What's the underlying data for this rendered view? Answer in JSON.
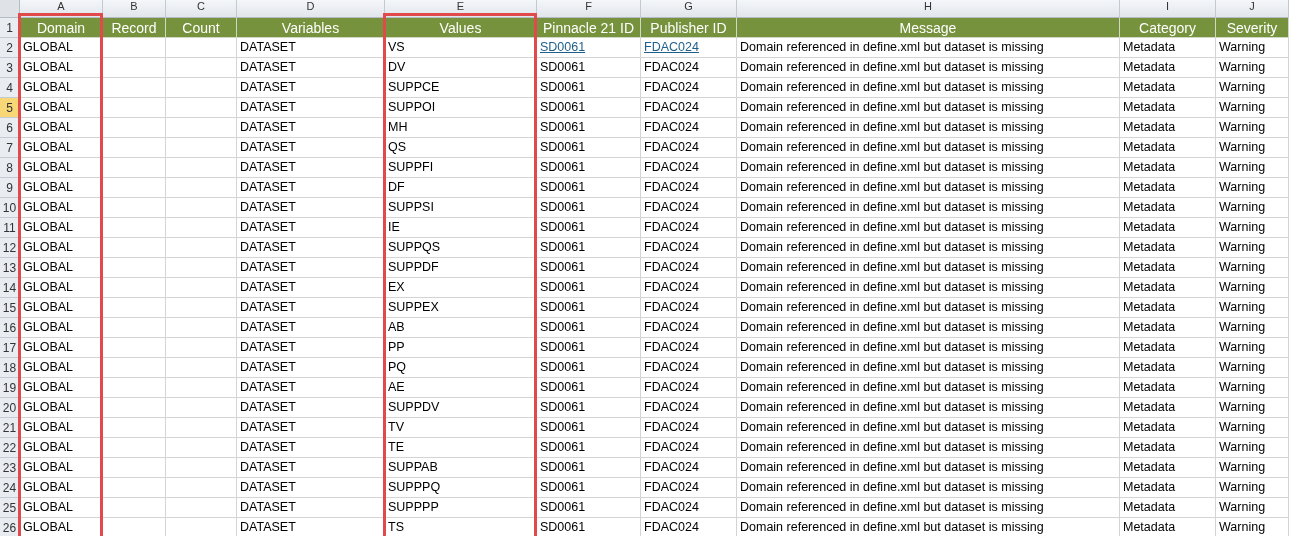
{
  "columns": [
    {
      "letter": "A",
      "heading": "Domain",
      "framed": true
    },
    {
      "letter": "B",
      "heading": "Record",
      "framed": false
    },
    {
      "letter": "C",
      "heading": "Count",
      "framed": false
    },
    {
      "letter": "D",
      "heading": "Variables",
      "framed": false
    },
    {
      "letter": "E",
      "heading": "Values",
      "framed": true
    },
    {
      "letter": "F",
      "heading": "Pinnacle 21 ID",
      "framed": false
    },
    {
      "letter": "G",
      "heading": "Publisher ID",
      "framed": false
    },
    {
      "letter": "H",
      "heading": "Message",
      "framed": false
    },
    {
      "letter": "I",
      "heading": "Category",
      "framed": false
    },
    {
      "letter": "J",
      "heading": "Severity",
      "framed": false
    }
  ],
  "header_row_number": "1",
  "rows": [
    {
      "number": "2",
      "selected": false,
      "linked": true,
      "domain": "GLOBAL",
      "variables": "DATASET",
      "values": "VS",
      "pinnacle_id": "SD0061",
      "publisher_id": "FDAC024",
      "message": "Domain referenced in define.xml but dataset is missing",
      "category": "Metadata",
      "severity": "Warning"
    },
    {
      "number": "3",
      "selected": false,
      "linked": false,
      "domain": "GLOBAL",
      "variables": "DATASET",
      "values": "DV",
      "pinnacle_id": "SD0061",
      "publisher_id": "FDAC024",
      "message": "Domain referenced in define.xml but dataset is missing",
      "category": "Metadata",
      "severity": "Warning"
    },
    {
      "number": "4",
      "selected": false,
      "linked": false,
      "domain": "GLOBAL",
      "variables": "DATASET",
      "values": "SUPPCE",
      "pinnacle_id": "SD0061",
      "publisher_id": "FDAC024",
      "message": "Domain referenced in define.xml but dataset is missing",
      "category": "Metadata",
      "severity": "Warning"
    },
    {
      "number": "5",
      "selected": true,
      "linked": false,
      "domain": "GLOBAL",
      "variables": "DATASET",
      "values": "SUPPOI",
      "pinnacle_id": "SD0061",
      "publisher_id": "FDAC024",
      "message": "Domain referenced in define.xml but dataset is missing",
      "category": "Metadata",
      "severity": "Warning"
    },
    {
      "number": "6",
      "selected": false,
      "linked": false,
      "domain": "GLOBAL",
      "variables": "DATASET",
      "values": "MH",
      "pinnacle_id": "SD0061",
      "publisher_id": "FDAC024",
      "message": "Domain referenced in define.xml but dataset is missing",
      "category": "Metadata",
      "severity": "Warning"
    },
    {
      "number": "7",
      "selected": false,
      "linked": false,
      "domain": "GLOBAL",
      "variables": "DATASET",
      "values": "QS",
      "pinnacle_id": "SD0061",
      "publisher_id": "FDAC024",
      "message": "Domain referenced in define.xml but dataset is missing",
      "category": "Metadata",
      "severity": "Warning"
    },
    {
      "number": "8",
      "selected": false,
      "linked": false,
      "domain": "GLOBAL",
      "variables": "DATASET",
      "values": "SUPPFI",
      "pinnacle_id": "SD0061",
      "publisher_id": "FDAC024",
      "message": "Domain referenced in define.xml but dataset is missing",
      "category": "Metadata",
      "severity": "Warning"
    },
    {
      "number": "9",
      "selected": false,
      "linked": false,
      "domain": "GLOBAL",
      "variables": "DATASET",
      "values": "DF",
      "pinnacle_id": "SD0061",
      "publisher_id": "FDAC024",
      "message": "Domain referenced in define.xml but dataset is missing",
      "category": "Metadata",
      "severity": "Warning"
    },
    {
      "number": "10",
      "selected": false,
      "linked": false,
      "domain": "GLOBAL",
      "variables": "DATASET",
      "values": "SUPPSI",
      "pinnacle_id": "SD0061",
      "publisher_id": "FDAC024",
      "message": "Domain referenced in define.xml but dataset is missing",
      "category": "Metadata",
      "severity": "Warning"
    },
    {
      "number": "11",
      "selected": false,
      "linked": false,
      "domain": "GLOBAL",
      "variables": "DATASET",
      "values": "IE",
      "pinnacle_id": "SD0061",
      "publisher_id": "FDAC024",
      "message": "Domain referenced in define.xml but dataset is missing",
      "category": "Metadata",
      "severity": "Warning"
    },
    {
      "number": "12",
      "selected": false,
      "linked": false,
      "domain": "GLOBAL",
      "variables": "DATASET",
      "values": "SUPPQS",
      "pinnacle_id": "SD0061",
      "publisher_id": "FDAC024",
      "message": "Domain referenced in define.xml but dataset is missing",
      "category": "Metadata",
      "severity": "Warning"
    },
    {
      "number": "13",
      "selected": false,
      "linked": false,
      "domain": "GLOBAL",
      "variables": "DATASET",
      "values": "SUPPDF",
      "pinnacle_id": "SD0061",
      "publisher_id": "FDAC024",
      "message": "Domain referenced in define.xml but dataset is missing",
      "category": "Metadata",
      "severity": "Warning"
    },
    {
      "number": "14",
      "selected": false,
      "linked": false,
      "domain": "GLOBAL",
      "variables": "DATASET",
      "values": "EX",
      "pinnacle_id": "SD0061",
      "publisher_id": "FDAC024",
      "message": "Domain referenced in define.xml but dataset is missing",
      "category": "Metadata",
      "severity": "Warning"
    },
    {
      "number": "15",
      "selected": false,
      "linked": false,
      "domain": "GLOBAL",
      "variables": "DATASET",
      "values": "SUPPEX",
      "pinnacle_id": "SD0061",
      "publisher_id": "FDAC024",
      "message": "Domain referenced in define.xml but dataset is missing",
      "category": "Metadata",
      "severity": "Warning"
    },
    {
      "number": "16",
      "selected": false,
      "linked": false,
      "domain": "GLOBAL",
      "variables": "DATASET",
      "values": "AB",
      "pinnacle_id": "SD0061",
      "publisher_id": "FDAC024",
      "message": "Domain referenced in define.xml but dataset is missing",
      "category": "Metadata",
      "severity": "Warning"
    },
    {
      "number": "17",
      "selected": false,
      "linked": false,
      "domain": "GLOBAL",
      "variables": "DATASET",
      "values": "PP",
      "pinnacle_id": "SD0061",
      "publisher_id": "FDAC024",
      "message": "Domain referenced in define.xml but dataset is missing",
      "category": "Metadata",
      "severity": "Warning"
    },
    {
      "number": "18",
      "selected": false,
      "linked": false,
      "domain": "GLOBAL",
      "variables": "DATASET",
      "values": "PQ",
      "pinnacle_id": "SD0061",
      "publisher_id": "FDAC024",
      "message": "Domain referenced in define.xml but dataset is missing",
      "category": "Metadata",
      "severity": "Warning"
    },
    {
      "number": "19",
      "selected": false,
      "linked": false,
      "domain": "GLOBAL",
      "variables": "DATASET",
      "values": "AE",
      "pinnacle_id": "SD0061",
      "publisher_id": "FDAC024",
      "message": "Domain referenced in define.xml but dataset is missing",
      "category": "Metadata",
      "severity": "Warning"
    },
    {
      "number": "20",
      "selected": false,
      "linked": false,
      "domain": "GLOBAL",
      "variables": "DATASET",
      "values": "SUPPDV",
      "pinnacle_id": "SD0061",
      "publisher_id": "FDAC024",
      "message": "Domain referenced in define.xml but dataset is missing",
      "category": "Metadata",
      "severity": "Warning"
    },
    {
      "number": "21",
      "selected": false,
      "linked": false,
      "domain": "GLOBAL",
      "variables": "DATASET",
      "values": "TV",
      "pinnacle_id": "SD0061",
      "publisher_id": "FDAC024",
      "message": "Domain referenced in define.xml but dataset is missing",
      "category": "Metadata",
      "severity": "Warning"
    },
    {
      "number": "22",
      "selected": false,
      "linked": false,
      "domain": "GLOBAL",
      "variables": "DATASET",
      "values": "TE",
      "pinnacle_id": "SD0061",
      "publisher_id": "FDAC024",
      "message": "Domain referenced in define.xml but dataset is missing",
      "category": "Metadata",
      "severity": "Warning"
    },
    {
      "number": "23",
      "selected": false,
      "linked": false,
      "domain": "GLOBAL",
      "variables": "DATASET",
      "values": "SUPPAB",
      "pinnacle_id": "SD0061",
      "publisher_id": "FDAC024",
      "message": "Domain referenced in define.xml but dataset is missing",
      "category": "Metadata",
      "severity": "Warning"
    },
    {
      "number": "24",
      "selected": false,
      "linked": false,
      "domain": "GLOBAL",
      "variables": "DATASET",
      "values": "SUPPPQ",
      "pinnacle_id": "SD0061",
      "publisher_id": "FDAC024",
      "message": "Domain referenced in define.xml but dataset is missing",
      "category": "Metadata",
      "severity": "Warning"
    },
    {
      "number": "25",
      "selected": false,
      "linked": false,
      "domain": "GLOBAL",
      "variables": "DATASET",
      "values": "SUPPPP",
      "pinnacle_id": "SD0061",
      "publisher_id": "FDAC024",
      "message": "Domain referenced in define.xml but dataset is missing",
      "category": "Metadata",
      "severity": "Warning"
    },
    {
      "number": "26",
      "selected": false,
      "linked": false,
      "domain": "GLOBAL",
      "variables": "DATASET",
      "values": "TS",
      "pinnacle_id": "SD0061",
      "publisher_id": "FDAC024",
      "message": "Domain referenced in define.xml but dataset is missing",
      "category": "Metadata",
      "severity": "Warning"
    }
  ]
}
